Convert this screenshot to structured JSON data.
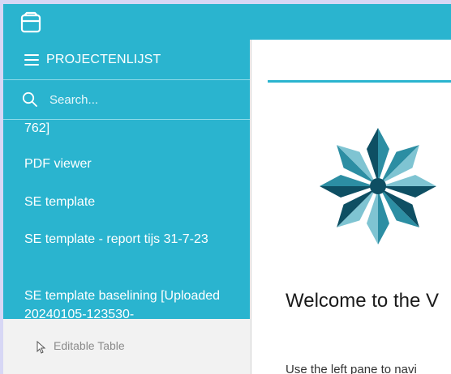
{
  "colors": {
    "accent": "#2ab4cf",
    "logo_dark": "#0e4f63",
    "logo_mid": "#2c8ea3",
    "logo_light": "#7fc4d2"
  },
  "header": {
    "app_icon": "database-icon"
  },
  "sidebar": {
    "dropdown": {
      "title": "PROJECTENLIJST",
      "search_placeholder": "Search...",
      "items": [
        "762]",
        "PDF viewer",
        "SE template",
        "SE template - report tijs 31-7-23",
        "SE template baselining [Uploaded 20240105-123530-"
      ]
    },
    "background_item": "Editable Table"
  },
  "main": {
    "welcome": "Welcome to the V",
    "help": "Use the left pane to navi"
  }
}
